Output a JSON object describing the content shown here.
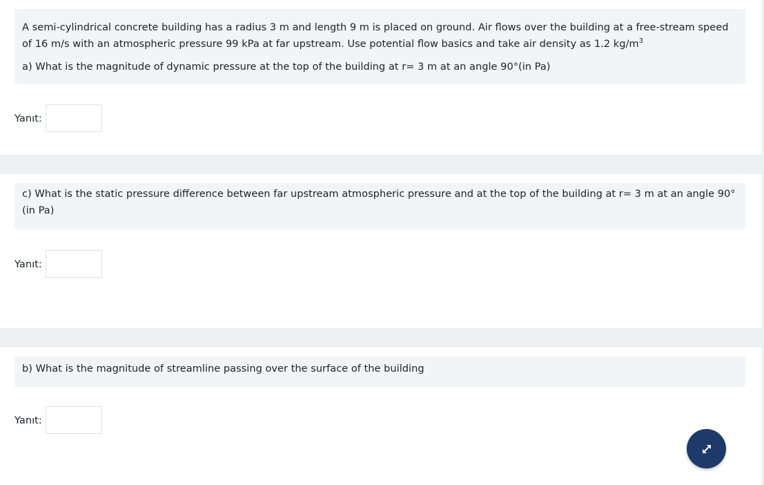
{
  "questions": {
    "a": {
      "intro_text": "A semi-cylindrical concrete building has a radius 3 m and length 9 m is placed on ground. Air  flows over the building at  a  free-stream speed of 16 m/s with an atmospheric  pressure 99 kPa at far upstream. Use  potential flow basics and take air density as  1.2 kg/m",
      "intro_superscript": "3",
      "question_text": "a) What is the magnitude of  dynamic pressure  at  the top of the building at r= 3 m at an angle 90°(in Pa)",
      "answer_label": "Yanıt:",
      "answer_value": ""
    },
    "c": {
      "question_text": "c)  What is the   static pressure  difference between far upstream  atmospheric pressure  and at the  top of the building at r= 3 m at an angle 90°(in Pa)",
      "answer_label": "Yanıt:",
      "answer_value": ""
    },
    "b": {
      "question_text": "b) What is the magnitude of streamline passing over the surface of the building",
      "answer_label": "Yanıt:",
      "answer_value": ""
    }
  },
  "fab": {
    "icon": "expand-arrows-icon",
    "background": "#1d3a6a"
  },
  "colors": {
    "question_background": "#f2f5f8",
    "separator_background": "#eef1f4",
    "text": "#1d2125"
  }
}
